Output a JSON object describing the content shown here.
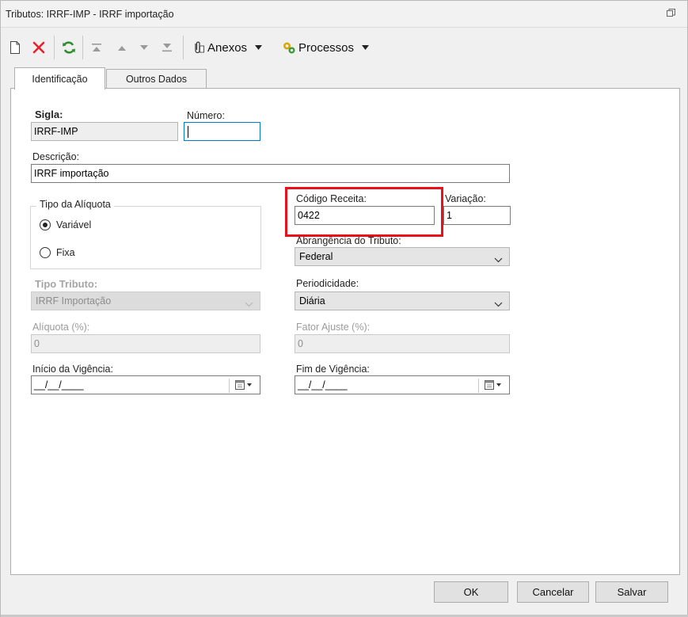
{
  "window": {
    "title": "Tributos: IRRF-IMP - IRRF importação",
    "restore_icon": "restore-icon"
  },
  "toolbar": {
    "new_icon": "new-document-icon",
    "delete_icon": "delete-icon",
    "refresh_icon": "refresh-icon",
    "first_icon": "first-record-icon",
    "prev_icon": "previous-record-icon",
    "next_icon": "next-record-icon",
    "last_icon": "last-record-icon",
    "attachments_label": "Anexos",
    "processes_label": "Processos"
  },
  "tabs": [
    {
      "label": "Identificação",
      "active": true
    },
    {
      "label": "Outros Dados",
      "active": false
    }
  ],
  "form": {
    "sigla": {
      "label": "Sigla:",
      "value": "IRRF-IMP"
    },
    "numero": {
      "label": "Número:",
      "value": ""
    },
    "descricao": {
      "label": "Descrição:",
      "value": "IRRF importação"
    },
    "tipo_aliquota": {
      "title": "Tipo da Alíquota",
      "options": [
        {
          "label": "Variável",
          "selected": true
        },
        {
          "label": "Fixa",
          "selected": false
        }
      ]
    },
    "codigo_receita": {
      "label": "Código Receita:",
      "value": "0422"
    },
    "variacao": {
      "label": "Variação:",
      "value": "1"
    },
    "abrangencia": {
      "label": "Abrangência do Tributo:",
      "value": "Federal"
    },
    "tipo_tributo": {
      "label": "Tipo Tributo:",
      "value": "IRRF Importação"
    },
    "periodicidade": {
      "label": "Periodicidade:",
      "value": "Diária"
    },
    "aliquota": {
      "label": "Alíquota (%):",
      "value": "0"
    },
    "fator_ajuste": {
      "label": "Fator Ajuste (%):",
      "value": "0"
    },
    "inicio_vigencia": {
      "label": "Início da Vigência:",
      "value": "__/__/____"
    },
    "fim_vigencia": {
      "label": "Fim de Vigência:",
      "value": "__/__/____"
    }
  },
  "buttons": {
    "ok": "OK",
    "cancel": "Cancelar",
    "save": "Salvar"
  },
  "colors": {
    "highlight": "#e8101a",
    "focus_border": "#0078d7",
    "panel_bg": "#ffffff",
    "window_bg": "#f0f0f0"
  }
}
